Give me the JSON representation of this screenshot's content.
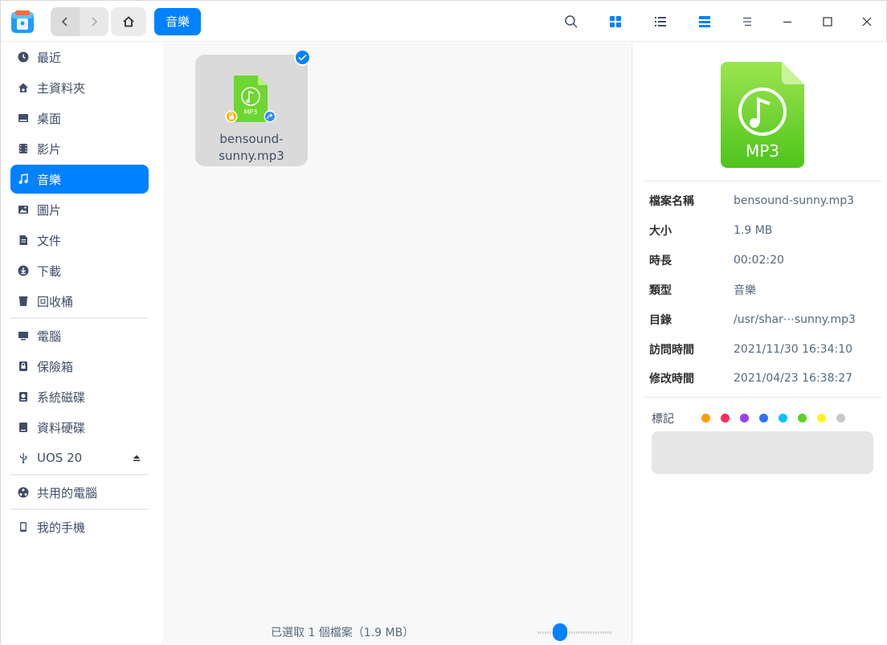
{
  "window": {
    "breadcrumb": "音樂"
  },
  "sidebar": {
    "items": [
      {
        "label": "最近",
        "icon": "clock-icon"
      },
      {
        "label": "主資料夾",
        "icon": "home-icon"
      },
      {
        "label": "桌面",
        "icon": "desktop-icon"
      },
      {
        "label": "影片",
        "icon": "film-icon"
      },
      {
        "label": "音樂",
        "icon": "music-icon",
        "active": true
      },
      {
        "label": "圖片",
        "icon": "image-icon"
      },
      {
        "label": "文件",
        "icon": "document-icon"
      },
      {
        "label": "下載",
        "icon": "download-icon"
      },
      {
        "label": "回收桶",
        "icon": "trash-icon"
      }
    ],
    "devices": [
      {
        "label": "電腦",
        "icon": "computer-icon"
      },
      {
        "label": "保險箱",
        "icon": "vault-icon"
      },
      {
        "label": "系統磁碟",
        "icon": "system-disk-icon"
      },
      {
        "label": "資料硬碟",
        "icon": "data-disk-icon"
      },
      {
        "label": "UOS 20",
        "icon": "usb-icon"
      }
    ],
    "network": [
      {
        "label": "共用的電腦",
        "icon": "network-icon"
      }
    ],
    "phone": [
      {
        "label": "我的手機",
        "icon": "phone-icon"
      }
    ]
  },
  "main": {
    "file": {
      "name_line1": "bensound-",
      "name_line2": "sunny.mp3",
      "icon_text": "MP3"
    },
    "status": "已選取 1 個檔案（1.9 MB）",
    "zoom_level": 0.25
  },
  "detail": {
    "icon_text": "MP3",
    "rows": [
      {
        "key": "檔案名稱",
        "value": "bensound-sunny.mp3"
      },
      {
        "key": "大小",
        "value": "1.9 MB"
      },
      {
        "key": "時長",
        "value": "00:02:20"
      },
      {
        "key": "類型",
        "value": "音樂"
      },
      {
        "key": "目錄",
        "value": "/usr/shar⋯sunny.mp3"
      },
      {
        "key": "訪問時間",
        "value": "2021/11/30 16:34:10"
      },
      {
        "key": "修改時間",
        "value": "2021/04/23 16:38:27"
      }
    ],
    "tag_label": "標記",
    "tag_colors": [
      "#ff9c00",
      "#ff2d55",
      "#9f3ff4",
      "#2e74ff",
      "#00c2ff",
      "#59d322",
      "#fff222",
      "#c8c8c8"
    ]
  },
  "colors": {
    "accent": "#0081ff",
    "mp3_green": "#6ed630"
  }
}
